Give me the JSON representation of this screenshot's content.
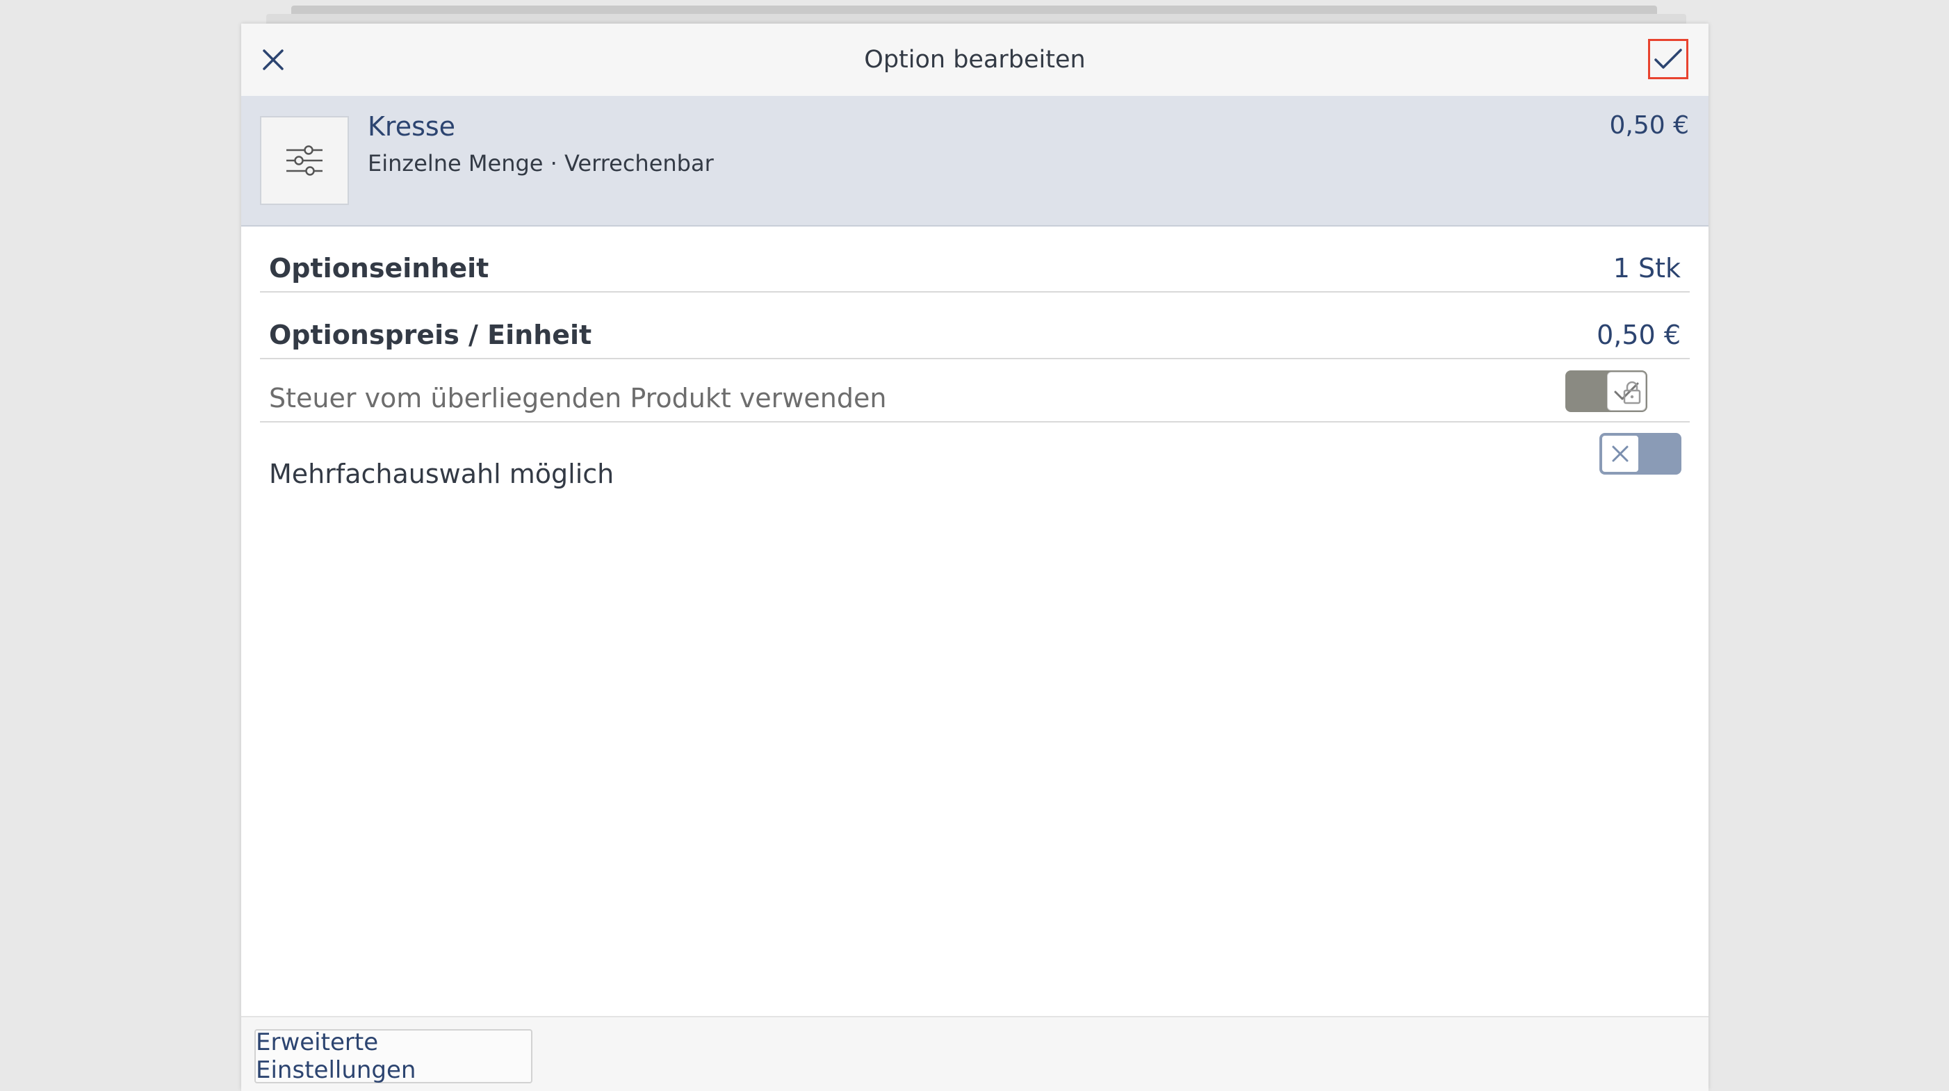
{
  "header": {
    "title": "Option bearbeiten",
    "close_icon": "close-icon",
    "confirm_icon": "check-icon"
  },
  "product": {
    "name": "Kresse",
    "subtitle": "Einzelne Menge · Verrechenbar",
    "price": "0,50 €",
    "icon": "sliders-icon"
  },
  "rows": {
    "unit": {
      "label": "Optionseinheit",
      "value": "1 Stk"
    },
    "price": {
      "label": "Optionspreis / Einheit",
      "value": "0,50 €"
    },
    "tax": {
      "label": "Steuer vom überliegenden Produkt verwenden",
      "enabled": true,
      "locked": true
    },
    "multi": {
      "label": "Mehrfachauswahl möglich",
      "enabled": false
    }
  },
  "footer": {
    "advanced_label": "Erweiterte Einstellungen"
  },
  "colors": {
    "accent": "#2c4470",
    "highlight_border": "#e8432f",
    "band": "#dee2ea"
  }
}
